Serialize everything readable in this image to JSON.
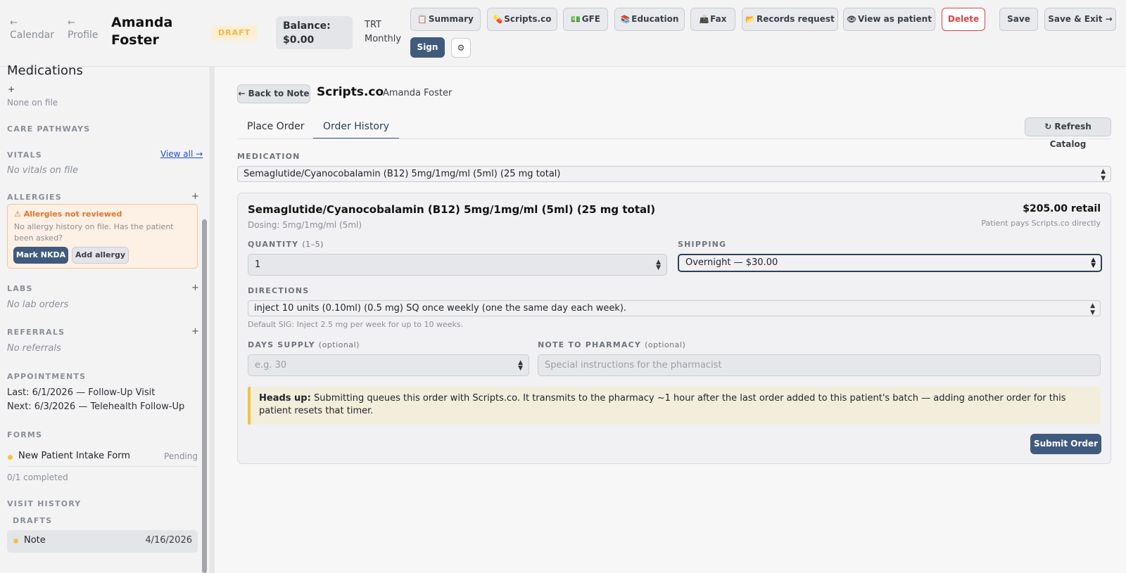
{
  "header": {
    "nav_calendar": "Calendar",
    "nav_profile": "Profile",
    "back_arrow": "←",
    "patient_first": "Amanda",
    "patient_last": "Foster",
    "status_badge": "DRAFT",
    "balance_label": "Balance:",
    "balance_value": "$0.00",
    "program_name": "TRT",
    "program_freq": "Monthly",
    "buttons": {
      "summary": "Summary",
      "scripts": "Scripts.co",
      "gfe": "GFE",
      "education": "Education",
      "fax": "Fax",
      "records": "Records request",
      "view_patient": "View as patient",
      "delete": "Delete",
      "save": "Save",
      "save_exit": "Save & Exit →",
      "sign": "Sign"
    },
    "icons": {
      "summary": "📋",
      "scripts": "💊",
      "gfe": "💵",
      "education": "📚",
      "fax": "📠",
      "records": "📂",
      "view_patient": "👁",
      "gear": "⚙"
    }
  },
  "sidebar": {
    "medications_title": "Medications",
    "medications_add": "+",
    "medications_empty": "None on file",
    "care_pathways": "CARE PATHWAYS",
    "vitals": "VITALS",
    "vitals_link": "View all →",
    "vitals_empty": "No vitals on file",
    "allergies": "ALLERGIES",
    "add_icon": "+",
    "allergy_warning_title": "⚠ Allergies not reviewed",
    "allergy_warning_text": "No allergy history on file. Has the patient been asked?",
    "mark_nkda": "Mark NKDA",
    "add_allergy": "Add allergy",
    "labs": "LABS",
    "labs_empty": "No lab orders",
    "referrals": "REFERRALS",
    "referrals_empty": "No referrals",
    "appointments": "APPOINTMENTS",
    "appt_last": "Last: 6/1/2026 — Follow-Up Visit",
    "appt_next": "Next: 6/3/2026 — Telehealth Follow-Up",
    "forms": "FORMS",
    "form_name": "New Patient Intake Form",
    "form_status": "Pending",
    "forms_completed": "0/1 completed",
    "visit_history": "VISIT HISTORY",
    "drafts": "DRAFTS",
    "draft_label": "Note",
    "draft_date": "4/16/2026"
  },
  "main": {
    "back_button": "← Back to Note",
    "title": "Scripts.co",
    "subtitle": "Amanda Foster",
    "tabs": [
      "Place Order",
      "Order History"
    ],
    "active_tab": "Order History",
    "refresh_button": "↻ Refresh Catalog",
    "medication_label": "MEDICATION",
    "medication_value": "Semaglutide/Cyanocobalamin (B12) 5mg/1mg/ml (5ml) (25 mg total)",
    "card": {
      "title": "Semaglutide/Cyanocobalamin (B12) 5mg/1mg/ml (5ml) (25 mg total)",
      "dosing": "Dosing: 5mg/1mg/ml (5ml)",
      "price": "$205.00 retail",
      "price_note": "Patient pays Scripts.co directly",
      "quantity_label": "QUANTITY",
      "quantity_hint": "(1–5)",
      "quantity_value": "1",
      "shipping_label": "SHIPPING",
      "shipping_value": "Overnight — $30.00",
      "directions_label": "DIRECTIONS",
      "directions_value": "inject 10 units (0.10ml) (0.5 mg) SQ once weekly (one the same day each week).",
      "default_sig": "Default SIG: Inject 2.5 mg per week for up to 10 weeks.",
      "days_supply_label": "DAYS SUPPLY",
      "days_supply_hint": "(optional)",
      "days_supply_placeholder": "e.g. 30",
      "note_label": "NOTE TO PHARMACY",
      "note_hint": "(optional)",
      "note_placeholder": "Special instructions for the pharmacist",
      "notice_strong": "Heads up:",
      "notice_text": "Submitting queues this order with Scripts.co. It transmits to the pharmacy ~1 hour after the last order added to this patient's batch — adding another order for this patient resets that timer.",
      "submit": "Submit Order"
    }
  },
  "colors": {
    "accent": "#3f5a7d",
    "danger": "#d64545",
    "warning": "#e0752d",
    "draft": "#f5b342"
  }
}
